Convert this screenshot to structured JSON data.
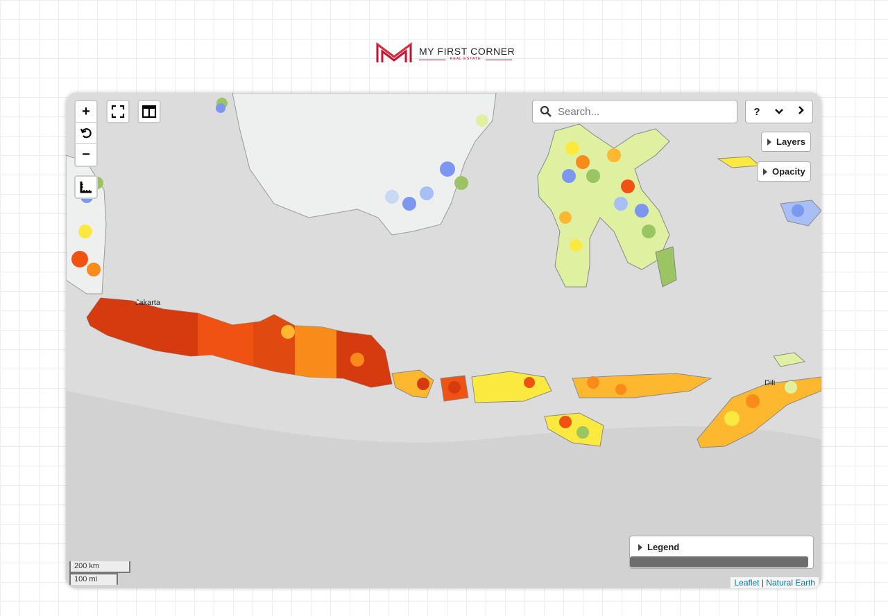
{
  "brand": {
    "name": "MY FIRST CORNER",
    "subtitle": "REAL ESTATE",
    "accent_color": "#c8102e"
  },
  "map": {
    "controls": {
      "zoom_in": "+",
      "reset_icon": "reset-view-icon",
      "zoom_out": "−",
      "fullscreen_icon": "fullscreen-icon",
      "split_icon": "split-view-icon",
      "ruler_icon": "measure-icon"
    },
    "search": {
      "placeholder": "Search..."
    },
    "nav": {
      "help": "?",
      "down": "⌄",
      "next": "›"
    },
    "panels": {
      "layers": "Layers",
      "opacity": "Opacity"
    },
    "legend": {
      "title": "Legend"
    },
    "scale": {
      "km": "200 km",
      "mi": "100 mi"
    },
    "attribution": {
      "leaflet": "Leaflet",
      "separator": " | ",
      "natural_earth": "Natural Earth"
    },
    "labels": {
      "jakarta": "Jakarta",
      "dili": "Dili"
    },
    "hex_palette": {
      "blue": "#7b97f0",
      "light_blue": "#a8bff5",
      "pale_blue": "#c9d9f3",
      "green": "#9bc463",
      "pale_green": "#dff0a0",
      "yellow": "#fce93f",
      "light_orange": "#fdb82f",
      "orange": "#f98b1a",
      "red_orange": "#f05212",
      "dark_red": "#d63b10"
    },
    "land_color": "#eef0f0",
    "sea_color": "#dcdcdc"
  }
}
